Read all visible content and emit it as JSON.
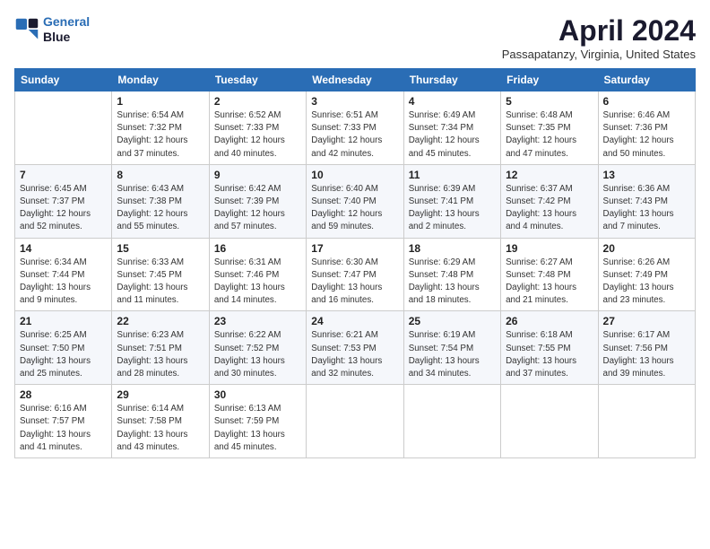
{
  "header": {
    "logo_line1": "General",
    "logo_line2": "Blue",
    "month": "April 2024",
    "location": "Passapatanzy, Virginia, United States"
  },
  "weekdays": [
    "Sunday",
    "Monday",
    "Tuesday",
    "Wednesday",
    "Thursday",
    "Friday",
    "Saturday"
  ],
  "weeks": [
    [
      {
        "day": "",
        "info": ""
      },
      {
        "day": "1",
        "info": "Sunrise: 6:54 AM\nSunset: 7:32 PM\nDaylight: 12 hours\nand 37 minutes."
      },
      {
        "day": "2",
        "info": "Sunrise: 6:52 AM\nSunset: 7:33 PM\nDaylight: 12 hours\nand 40 minutes."
      },
      {
        "day": "3",
        "info": "Sunrise: 6:51 AM\nSunset: 7:33 PM\nDaylight: 12 hours\nand 42 minutes."
      },
      {
        "day": "4",
        "info": "Sunrise: 6:49 AM\nSunset: 7:34 PM\nDaylight: 12 hours\nand 45 minutes."
      },
      {
        "day": "5",
        "info": "Sunrise: 6:48 AM\nSunset: 7:35 PM\nDaylight: 12 hours\nand 47 minutes."
      },
      {
        "day": "6",
        "info": "Sunrise: 6:46 AM\nSunset: 7:36 PM\nDaylight: 12 hours\nand 50 minutes."
      }
    ],
    [
      {
        "day": "7",
        "info": "Sunrise: 6:45 AM\nSunset: 7:37 PM\nDaylight: 12 hours\nand 52 minutes."
      },
      {
        "day": "8",
        "info": "Sunrise: 6:43 AM\nSunset: 7:38 PM\nDaylight: 12 hours\nand 55 minutes."
      },
      {
        "day": "9",
        "info": "Sunrise: 6:42 AM\nSunset: 7:39 PM\nDaylight: 12 hours\nand 57 minutes."
      },
      {
        "day": "10",
        "info": "Sunrise: 6:40 AM\nSunset: 7:40 PM\nDaylight: 12 hours\nand 59 minutes."
      },
      {
        "day": "11",
        "info": "Sunrise: 6:39 AM\nSunset: 7:41 PM\nDaylight: 13 hours\nand 2 minutes."
      },
      {
        "day": "12",
        "info": "Sunrise: 6:37 AM\nSunset: 7:42 PM\nDaylight: 13 hours\nand 4 minutes."
      },
      {
        "day": "13",
        "info": "Sunrise: 6:36 AM\nSunset: 7:43 PM\nDaylight: 13 hours\nand 7 minutes."
      }
    ],
    [
      {
        "day": "14",
        "info": "Sunrise: 6:34 AM\nSunset: 7:44 PM\nDaylight: 13 hours\nand 9 minutes."
      },
      {
        "day": "15",
        "info": "Sunrise: 6:33 AM\nSunset: 7:45 PM\nDaylight: 13 hours\nand 11 minutes."
      },
      {
        "day": "16",
        "info": "Sunrise: 6:31 AM\nSunset: 7:46 PM\nDaylight: 13 hours\nand 14 minutes."
      },
      {
        "day": "17",
        "info": "Sunrise: 6:30 AM\nSunset: 7:47 PM\nDaylight: 13 hours\nand 16 minutes."
      },
      {
        "day": "18",
        "info": "Sunrise: 6:29 AM\nSunset: 7:48 PM\nDaylight: 13 hours\nand 18 minutes."
      },
      {
        "day": "19",
        "info": "Sunrise: 6:27 AM\nSunset: 7:48 PM\nDaylight: 13 hours\nand 21 minutes."
      },
      {
        "day": "20",
        "info": "Sunrise: 6:26 AM\nSunset: 7:49 PM\nDaylight: 13 hours\nand 23 minutes."
      }
    ],
    [
      {
        "day": "21",
        "info": "Sunrise: 6:25 AM\nSunset: 7:50 PM\nDaylight: 13 hours\nand 25 minutes."
      },
      {
        "day": "22",
        "info": "Sunrise: 6:23 AM\nSunset: 7:51 PM\nDaylight: 13 hours\nand 28 minutes."
      },
      {
        "day": "23",
        "info": "Sunrise: 6:22 AM\nSunset: 7:52 PM\nDaylight: 13 hours\nand 30 minutes."
      },
      {
        "day": "24",
        "info": "Sunrise: 6:21 AM\nSunset: 7:53 PM\nDaylight: 13 hours\nand 32 minutes."
      },
      {
        "day": "25",
        "info": "Sunrise: 6:19 AM\nSunset: 7:54 PM\nDaylight: 13 hours\nand 34 minutes."
      },
      {
        "day": "26",
        "info": "Sunrise: 6:18 AM\nSunset: 7:55 PM\nDaylight: 13 hours\nand 37 minutes."
      },
      {
        "day": "27",
        "info": "Sunrise: 6:17 AM\nSunset: 7:56 PM\nDaylight: 13 hours\nand 39 minutes."
      }
    ],
    [
      {
        "day": "28",
        "info": "Sunrise: 6:16 AM\nSunset: 7:57 PM\nDaylight: 13 hours\nand 41 minutes."
      },
      {
        "day": "29",
        "info": "Sunrise: 6:14 AM\nSunset: 7:58 PM\nDaylight: 13 hours\nand 43 minutes."
      },
      {
        "day": "30",
        "info": "Sunrise: 6:13 AM\nSunset: 7:59 PM\nDaylight: 13 hours\nand 45 minutes."
      },
      {
        "day": "",
        "info": ""
      },
      {
        "day": "",
        "info": ""
      },
      {
        "day": "",
        "info": ""
      },
      {
        "day": "",
        "info": ""
      }
    ]
  ]
}
